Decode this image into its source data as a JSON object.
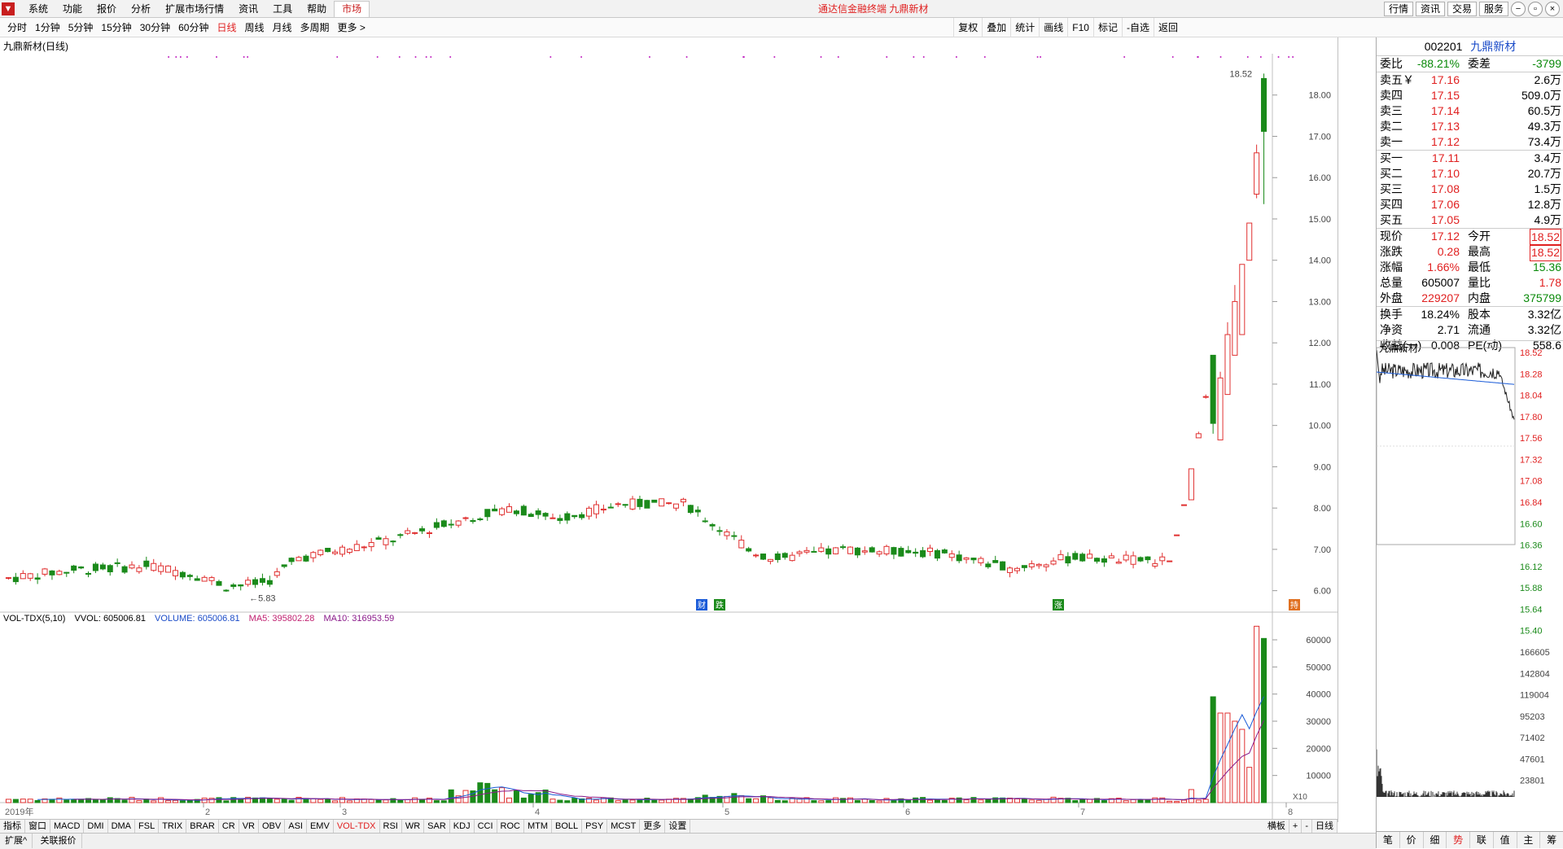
{
  "menubar": {
    "items": [
      "系统",
      "功能",
      "报价",
      "分析",
      "扩展市场行情",
      "资讯",
      "工具",
      "帮助",
      "市场"
    ],
    "active": "市场",
    "center_title": "通达信金融终端  九鼎新材",
    "right_buttons": [
      "行情",
      "资讯",
      "交易",
      "服务"
    ],
    "window_controls": [
      "−",
      "▫",
      "×"
    ]
  },
  "periodbar": {
    "periods": [
      "分时",
      "1分钟",
      "5分钟",
      "15分钟",
      "30分钟",
      "60分钟",
      "日线",
      "周线",
      "月线",
      "多周期",
      "更多 >"
    ],
    "active": "日线",
    "tools": [
      "复权",
      "叠加",
      "统计",
      "画线",
      "F10",
      "标记",
      "-自选",
      "返回"
    ]
  },
  "chart": {
    "title": "九鼎新材(日线)",
    "high_label": "18.52",
    "low_label": "5.83",
    "year_label": "2019年",
    "month_labels": [
      "2",
      "3",
      "4",
      "5",
      "6",
      "7",
      "8"
    ],
    "event_marks": [
      "财",
      "跌",
      "涨",
      "持"
    ],
    "vol_info": {
      "name": "VOL-TDX(5,10)",
      "vvol": "VVOL: 605006.81",
      "volume": "VOLUME: 605006.81",
      "ma5": "MA5: 395802.28",
      "ma10": "MA10: 316953.59"
    },
    "vol_unit": "X10"
  },
  "chart_data": {
    "type": "candlestick",
    "price_axis": [
      "18.00",
      "17.00",
      "16.00",
      "15.00",
      "14.00",
      "13.00",
      "12.00",
      "11.00",
      "10.00",
      "9.00",
      "8.00",
      "7.00",
      "6.00"
    ],
    "volume_axis": [
      "60000",
      "50000",
      "40000",
      "30000",
      "20000",
      "10000"
    ],
    "ylim_price": [
      5.5,
      19.0
    ],
    "ylim_volume": [
      0,
      66000
    ]
  },
  "indicators": {
    "items": [
      "指标",
      "窗口",
      "MACD",
      "DMI",
      "DMA",
      "FSL",
      "TRIX",
      "BRAR",
      "CR",
      "VR",
      "OBV",
      "ASI",
      "EMV",
      "VOL-TDX",
      "RSI",
      "WR",
      "SAR",
      "KDJ",
      "CCI",
      "ROC",
      "MTM",
      "BOLL",
      "PSY",
      "MCST",
      "更多",
      "设置"
    ],
    "active": "VOL-TDX",
    "mode": [
      "横板",
      "+",
      "-",
      "日线"
    ]
  },
  "bottombar": {
    "items": [
      "扩展^",
      "关联报价"
    ]
  },
  "quote": {
    "code": "002201",
    "name": "九鼎新材",
    "weibi": {
      "label": "委比",
      "value": "-88.21%",
      "label2": "委差",
      "value2": "-3799"
    },
    "sells": [
      {
        "label": "卖五￥",
        "price": "17.16",
        "vol": "2.6万"
      },
      {
        "label": "卖四",
        "price": "17.15",
        "vol": "509.0万"
      },
      {
        "label": "卖三",
        "price": "17.14",
        "vol": "60.5万"
      },
      {
        "label": "卖二",
        "price": "17.13",
        "vol": "49.3万"
      },
      {
        "label": "卖一",
        "price": "17.12",
        "vol": "73.4万"
      }
    ],
    "buys": [
      {
        "label": "买一",
        "price": "17.11",
        "vol": "3.4万"
      },
      {
        "label": "买二",
        "price": "17.10",
        "vol": "20.7万"
      },
      {
        "label": "买三",
        "price": "17.08",
        "vol": "1.5万"
      },
      {
        "label": "买四",
        "price": "17.06",
        "vol": "12.8万"
      },
      {
        "label": "买五",
        "price": "17.05",
        "vol": "4.9万"
      }
    ],
    "stats1": [
      {
        "l": "现价",
        "v": "17.12",
        "l2": "今开",
        "v2": "18.52",
        "c": "red",
        "c2": "red",
        "box2": true
      },
      {
        "l": "涨跌",
        "v": "0.28",
        "l2": "最高",
        "v2": "18.52",
        "c": "red",
        "c2": "red",
        "box2": true
      },
      {
        "l": "涨幅",
        "v": "1.66%",
        "l2": "最低",
        "v2": "15.36",
        "c": "red",
        "c2": "green"
      },
      {
        "l": "总量",
        "v": "605007",
        "l2": "量比",
        "v2": "1.78",
        "c": "",
        "c2": "red"
      },
      {
        "l": "外盘",
        "v": "229207",
        "l2": "内盘",
        "v2": "375799",
        "c": "red",
        "c2": "green"
      }
    ],
    "stats2": [
      {
        "l": "换手",
        "v": "18.24%",
        "l2": "股本",
        "v2": "3.32亿"
      },
      {
        "l": "净资",
        "v": "2.71",
        "l2": "流通",
        "v2": "3.32亿"
      },
      {
        "l": "收益(一)",
        "v": "0.008",
        "l2": "PE(动)",
        "v2": "558.6"
      }
    ],
    "mini_name": "九鼎新材",
    "mini_axis": [
      "18.52",
      "18.28",
      "18.04",
      "17.80",
      "17.56",
      "17.32",
      "17.08",
      "16.84",
      "16.60",
      "16.36",
      "16.12",
      "15.88",
      "15.64",
      "15.40"
    ],
    "mini_vol_axis": [
      "166605",
      "142804",
      "119004",
      "95203",
      "71402",
      "47601",
      "23801"
    ],
    "tabs": [
      "笔",
      "价",
      "细",
      "势",
      "联",
      "值",
      "主",
      "筹"
    ],
    "active_tab": "势"
  }
}
